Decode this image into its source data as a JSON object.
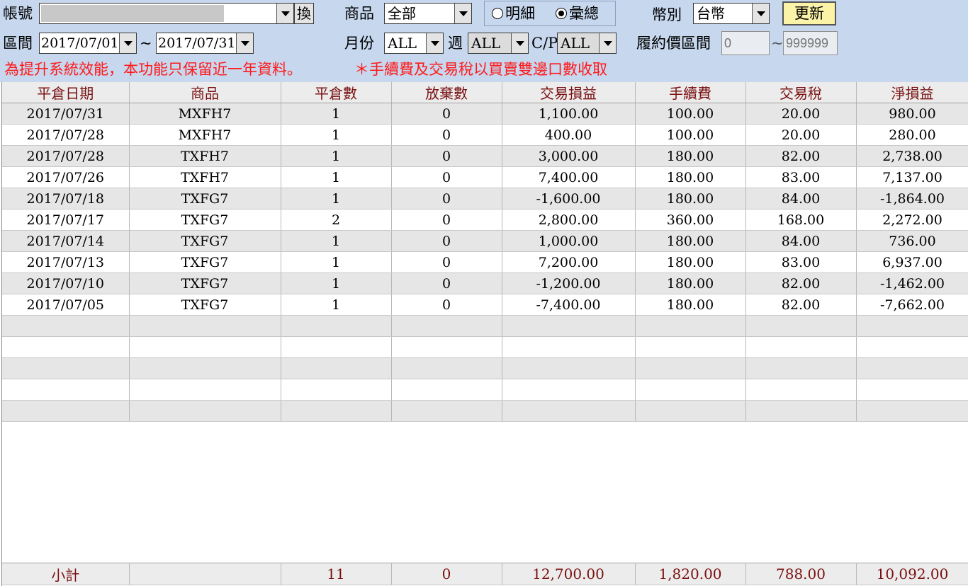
{
  "toolbar": {
    "account_label": "帳號",
    "account_value": "",
    "swap_label": "換",
    "product_label": "商品",
    "product_value": "全部",
    "radio_detail_label": "明細",
    "radio_summary_label": "彙總",
    "radio_selected": "summary",
    "currency_label": "幣別",
    "currency_value": "台幣",
    "refresh_label": "更新",
    "range_label": "區間",
    "date_from": "2017/07/01",
    "date_sep": "~",
    "date_to": "2017/07/31",
    "month_label": "月份",
    "month_value": "ALL",
    "week_label": "週",
    "week_value": "ALL",
    "cp_label": "C/P",
    "cp_value": "ALL",
    "strike_label": "履約價區間",
    "strike_min_placeholder": "0",
    "strike_sep": "~",
    "strike_max_placeholder": "999999"
  },
  "notices": {
    "left": "為提升系統效能，本功能只保留近一年資料。",
    "right": "＊手續費及交易稅以買賣雙邊口數收取"
  },
  "table": {
    "headers": [
      "平倉日期",
      "商品",
      "平倉數",
      "放棄數",
      "交易損益",
      "手續費",
      "交易稅",
      "淨損益"
    ],
    "rows": [
      [
        "2017/07/31",
        "MXFH7",
        "1",
        "0",
        "1,100.00",
        "100.00",
        "20.00",
        "980.00"
      ],
      [
        "2017/07/28",
        "MXFH7",
        "1",
        "0",
        "400.00",
        "100.00",
        "20.00",
        "280.00"
      ],
      [
        "2017/07/28",
        "TXFH7",
        "1",
        "0",
        "3,000.00",
        "180.00",
        "82.00",
        "2,738.00"
      ],
      [
        "2017/07/26",
        "TXFH7",
        "1",
        "0",
        "7,400.00",
        "180.00",
        "83.00",
        "7,137.00"
      ],
      [
        "2017/07/18",
        "TXFG7",
        "1",
        "0",
        "-1,600.00",
        "180.00",
        "84.00",
        "-1,864.00"
      ],
      [
        "2017/07/17",
        "TXFG7",
        "2",
        "0",
        "2,800.00",
        "360.00",
        "168.00",
        "2,272.00"
      ],
      [
        "2017/07/14",
        "TXFG7",
        "1",
        "0",
        "1,000.00",
        "180.00",
        "84.00",
        "736.00"
      ],
      [
        "2017/07/13",
        "TXFG7",
        "1",
        "0",
        "7,200.00",
        "180.00",
        "83.00",
        "6,937.00"
      ],
      [
        "2017/07/10",
        "TXFG7",
        "1",
        "0",
        "-1,200.00",
        "180.00",
        "82.00",
        "-1,462.00"
      ],
      [
        "2017/07/05",
        "TXFG7",
        "1",
        "0",
        "-7,400.00",
        "180.00",
        "82.00",
        "-7,662.00"
      ],
      [
        "",
        "",
        "",
        "",
        "",
        "",
        "",
        ""
      ],
      [
        "",
        "",
        "",
        "",
        "",
        "",
        "",
        ""
      ],
      [
        "",
        "",
        "",
        "",
        "",
        "",
        "",
        ""
      ],
      [
        "",
        "",
        "",
        "",
        "",
        "",
        "",
        ""
      ],
      [
        "",
        "",
        "",
        "",
        "",
        "",
        "",
        ""
      ]
    ],
    "subtotal": [
      "小計",
      "",
      "11",
      "0",
      "12,700.00",
      "1,820.00",
      "788.00",
      "10,092.00"
    ]
  }
}
